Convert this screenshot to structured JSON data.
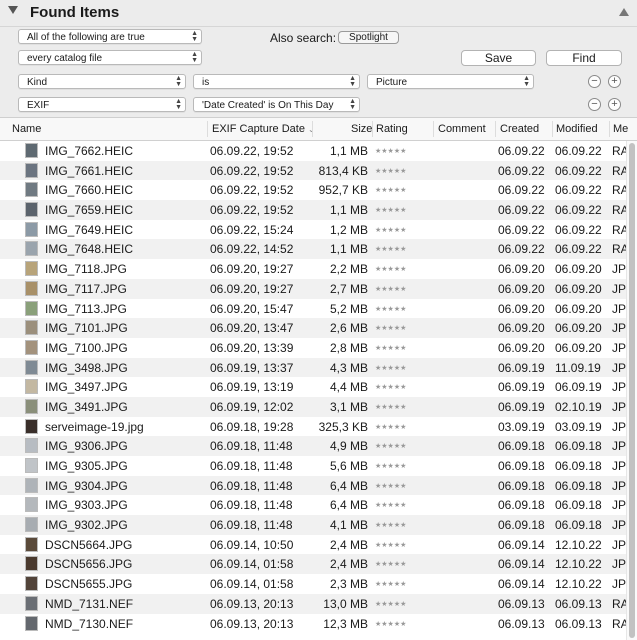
{
  "header": {
    "title": "Found Items"
  },
  "criteria": {
    "match_popup": "All of the following are true",
    "scope_popup": "every catalog file",
    "also_search_label": "Also search:",
    "spotlight_button": "Spotlight",
    "save_button": "Save",
    "find_button": "Find",
    "rules": [
      {
        "field": "Kind",
        "operator": "is",
        "value": "Picture"
      },
      {
        "field": "EXIF",
        "operator": "'Date Created' is On This Day"
      }
    ]
  },
  "columns": {
    "name": "Name",
    "exif": "EXIF Capture Date",
    "size": "Size",
    "rating": "Rating",
    "comment": "Comment",
    "created": "Created",
    "modified": "Modified",
    "me": "Me"
  },
  "rating_stars": "★★★★★",
  "colors": {
    "header_bg": "#ececec",
    "row_alt": "#f1f1f1"
  },
  "rows": [
    {
      "name": "IMG_7662.HEIC",
      "exif": "06.09.22, 19:52",
      "size": "1,1 MB",
      "created": "06.09.22",
      "modified": "06.09.22",
      "me": "RA",
      "thumb": "#5f6a72"
    },
    {
      "name": "IMG_7661.HEIC",
      "exif": "06.09.22, 19:52",
      "size": "813,4 KB",
      "created": "06.09.22",
      "modified": "06.09.22",
      "me": "RA",
      "thumb": "#6b7480"
    },
    {
      "name": "IMG_7660.HEIC",
      "exif": "06.09.22, 19:52",
      "size": "952,7 KB",
      "created": "06.09.22",
      "modified": "06.09.22",
      "me": "RA",
      "thumb": "#707a82"
    },
    {
      "name": "IMG_7659.HEIC",
      "exif": "06.09.22, 19:52",
      "size": "1,1 MB",
      "created": "06.09.22",
      "modified": "06.09.22",
      "me": "RA",
      "thumb": "#5b636c"
    },
    {
      "name": "IMG_7649.HEIC",
      "exif": "06.09.22, 15:24",
      "size": "1,2 MB",
      "created": "06.09.22",
      "modified": "06.09.22",
      "me": "RA",
      "thumb": "#8c9aa6"
    },
    {
      "name": "IMG_7648.HEIC",
      "exif": "06.09.22, 14:52",
      "size": "1,1 MB",
      "created": "06.09.22",
      "modified": "06.09.22",
      "me": "RA",
      "thumb": "#9aa4ad"
    },
    {
      "name": "IMG_7118.JPG",
      "exif": "06.09.20, 19:27",
      "size": "2,2 MB",
      "created": "06.09.20",
      "modified": "06.09.20",
      "me": "JP",
      "thumb": "#b8a47a"
    },
    {
      "name": "IMG_7117.JPG",
      "exif": "06.09.20, 19:27",
      "size": "2,7 MB",
      "created": "06.09.20",
      "modified": "06.09.20",
      "me": "JP",
      "thumb": "#a89068"
    },
    {
      "name": "IMG_7113.JPG",
      "exif": "06.09.20, 15:47",
      "size": "5,2 MB",
      "created": "06.09.20",
      "modified": "06.09.20",
      "me": "JP",
      "thumb": "#8aa07a"
    },
    {
      "name": "IMG_7101.JPG",
      "exif": "06.09.20, 13:47",
      "size": "2,6 MB",
      "created": "06.09.20",
      "modified": "06.09.20",
      "me": "JP",
      "thumb": "#9b8f7c"
    },
    {
      "name": "IMG_7100.JPG",
      "exif": "06.09.20, 13:39",
      "size": "2,8 MB",
      "created": "06.09.20",
      "modified": "06.09.20",
      "me": "JP",
      "thumb": "#a3927d"
    },
    {
      "name": "IMG_3498.JPG",
      "exif": "06.09.19, 13:37",
      "size": "4,3 MB",
      "created": "06.09.19",
      "modified": "11.09.19",
      "me": "JP",
      "thumb": "#7f8a94"
    },
    {
      "name": "IMG_3497.JPG",
      "exif": "06.09.19, 13:19",
      "size": "4,4 MB",
      "created": "06.09.19",
      "modified": "06.09.19",
      "me": "JP",
      "thumb": "#c3b8a2"
    },
    {
      "name": "IMG_3491.JPG",
      "exif": "06.09.19, 12:02",
      "size": "3,1 MB",
      "created": "06.09.19",
      "modified": "02.10.19",
      "me": "JP",
      "thumb": "#8a8f7a"
    },
    {
      "name": "serveimage-19.jpg",
      "exif": "06.09.18, 19:28",
      "size": "325,3 KB",
      "created": "03.09.19",
      "modified": "03.09.19",
      "me": "JP",
      "thumb": "#3a2f2a"
    },
    {
      "name": "IMG_9306.JPG",
      "exif": "06.09.18, 11:48",
      "size": "4,9 MB",
      "created": "06.09.18",
      "modified": "06.09.18",
      "me": "JP",
      "thumb": "#b7bcc2"
    },
    {
      "name": "IMG_9305.JPG",
      "exif": "06.09.18, 11:48",
      "size": "5,6 MB",
      "created": "06.09.18",
      "modified": "06.09.18",
      "me": "JP",
      "thumb": "#c0c4c8"
    },
    {
      "name": "IMG_9304.JPG",
      "exif": "06.09.18, 11:48",
      "size": "6,4 MB",
      "created": "06.09.18",
      "modified": "06.09.18",
      "me": "JP",
      "thumb": "#aeb3b8"
    },
    {
      "name": "IMG_9303.JPG",
      "exif": "06.09.18, 11:48",
      "size": "6,4 MB",
      "created": "06.09.18",
      "modified": "06.09.18",
      "me": "JP",
      "thumb": "#b4b8bc"
    },
    {
      "name": "IMG_9302.JPG",
      "exif": "06.09.18, 11:48",
      "size": "4,1 MB",
      "created": "06.09.18",
      "modified": "06.09.18",
      "me": "JP",
      "thumb": "#a7acb1"
    },
    {
      "name": "DSCN5664.JPG",
      "exif": "06.09.14, 10:50",
      "size": "2,4 MB",
      "created": "06.09.14",
      "modified": "12.10.22",
      "me": "JP",
      "thumb": "#5a4a3a"
    },
    {
      "name": "DSCN5656.JPG",
      "exif": "06.09.14, 01:58",
      "size": "2,4 MB",
      "created": "06.09.14",
      "modified": "12.10.22",
      "me": "JP",
      "thumb": "#4a3a2e"
    },
    {
      "name": "DSCN5655.JPG",
      "exif": "06.09.14, 01:58",
      "size": "2,3 MB",
      "created": "06.09.14",
      "modified": "12.10.22",
      "me": "JP",
      "thumb": "#52443a"
    },
    {
      "name": "NMD_7131.NEF",
      "exif": "06.09.13, 20:13",
      "size": "13,0 MB",
      "created": "06.09.13",
      "modified": "06.09.13",
      "me": "RA",
      "thumb": "#6a6e74"
    },
    {
      "name": "NMD_7130.NEF",
      "exif": "06.09.13, 20:13",
      "size": "12,3 MB",
      "created": "06.09.13",
      "modified": "06.09.13",
      "me": "RA",
      "thumb": "#64686e"
    }
  ]
}
